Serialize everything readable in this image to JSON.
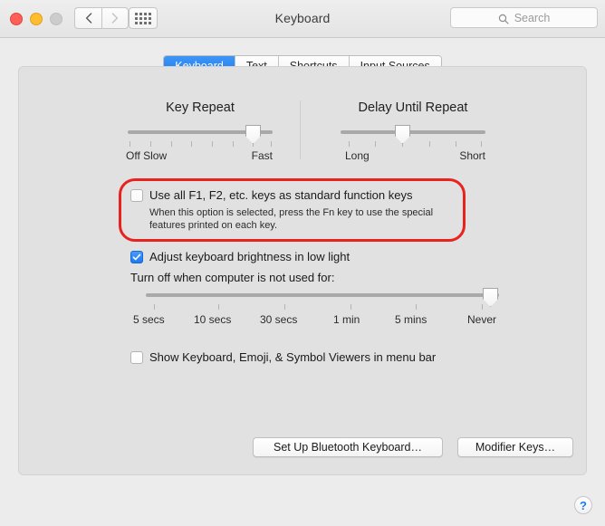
{
  "window": {
    "title": "Keyboard",
    "traffic_lights": [
      "close",
      "minimize",
      "zoom"
    ],
    "nav": {
      "back_icon": "chevron-left-icon",
      "forward_icon": "chevron-right-icon"
    },
    "grid_icon": "show-all-preferences-icon",
    "search": {
      "placeholder": "Search",
      "value": "",
      "icon": "search-icon"
    }
  },
  "tabs": [
    {
      "label": "Keyboard",
      "active": true
    },
    {
      "label": "Text",
      "active": false
    },
    {
      "label": "Shortcuts",
      "active": false
    },
    {
      "label": "Input Sources",
      "active": false
    }
  ],
  "key_repeat": {
    "title": "Key Repeat",
    "min_label": "Off Slow",
    "max_label": "Fast",
    "ticks": 8,
    "value_index": 7
  },
  "delay_until_repeat": {
    "title": "Delay Until Repeat",
    "min_label": "Long",
    "max_label": "Short",
    "ticks": 6,
    "value_index": 3
  },
  "function_keys": {
    "label": "Use all F1, F2, etc. keys as standard function keys",
    "checked": false,
    "description": "When this option is selected, press the Fn key to use the special features printed on each key.",
    "highlight_color": "#e8231f"
  },
  "brightness": {
    "label": "Adjust keyboard brightness in low light",
    "checked": true,
    "timeout_label": "Turn off when computer is not used for:",
    "timeout_options": [
      "5 secs",
      "10 secs",
      "30 secs",
      "1 min",
      "5 mins",
      "Never"
    ],
    "timeout_value": "Never",
    "timeout_value_index": 6
  },
  "viewers": {
    "label": "Show Keyboard, Emoji, & Symbol Viewers in menu bar",
    "checked": false
  },
  "buttons": {
    "bluetooth": "Set Up Bluetooth Keyboard…",
    "modifier": "Modifier Keys…",
    "help": "?"
  }
}
